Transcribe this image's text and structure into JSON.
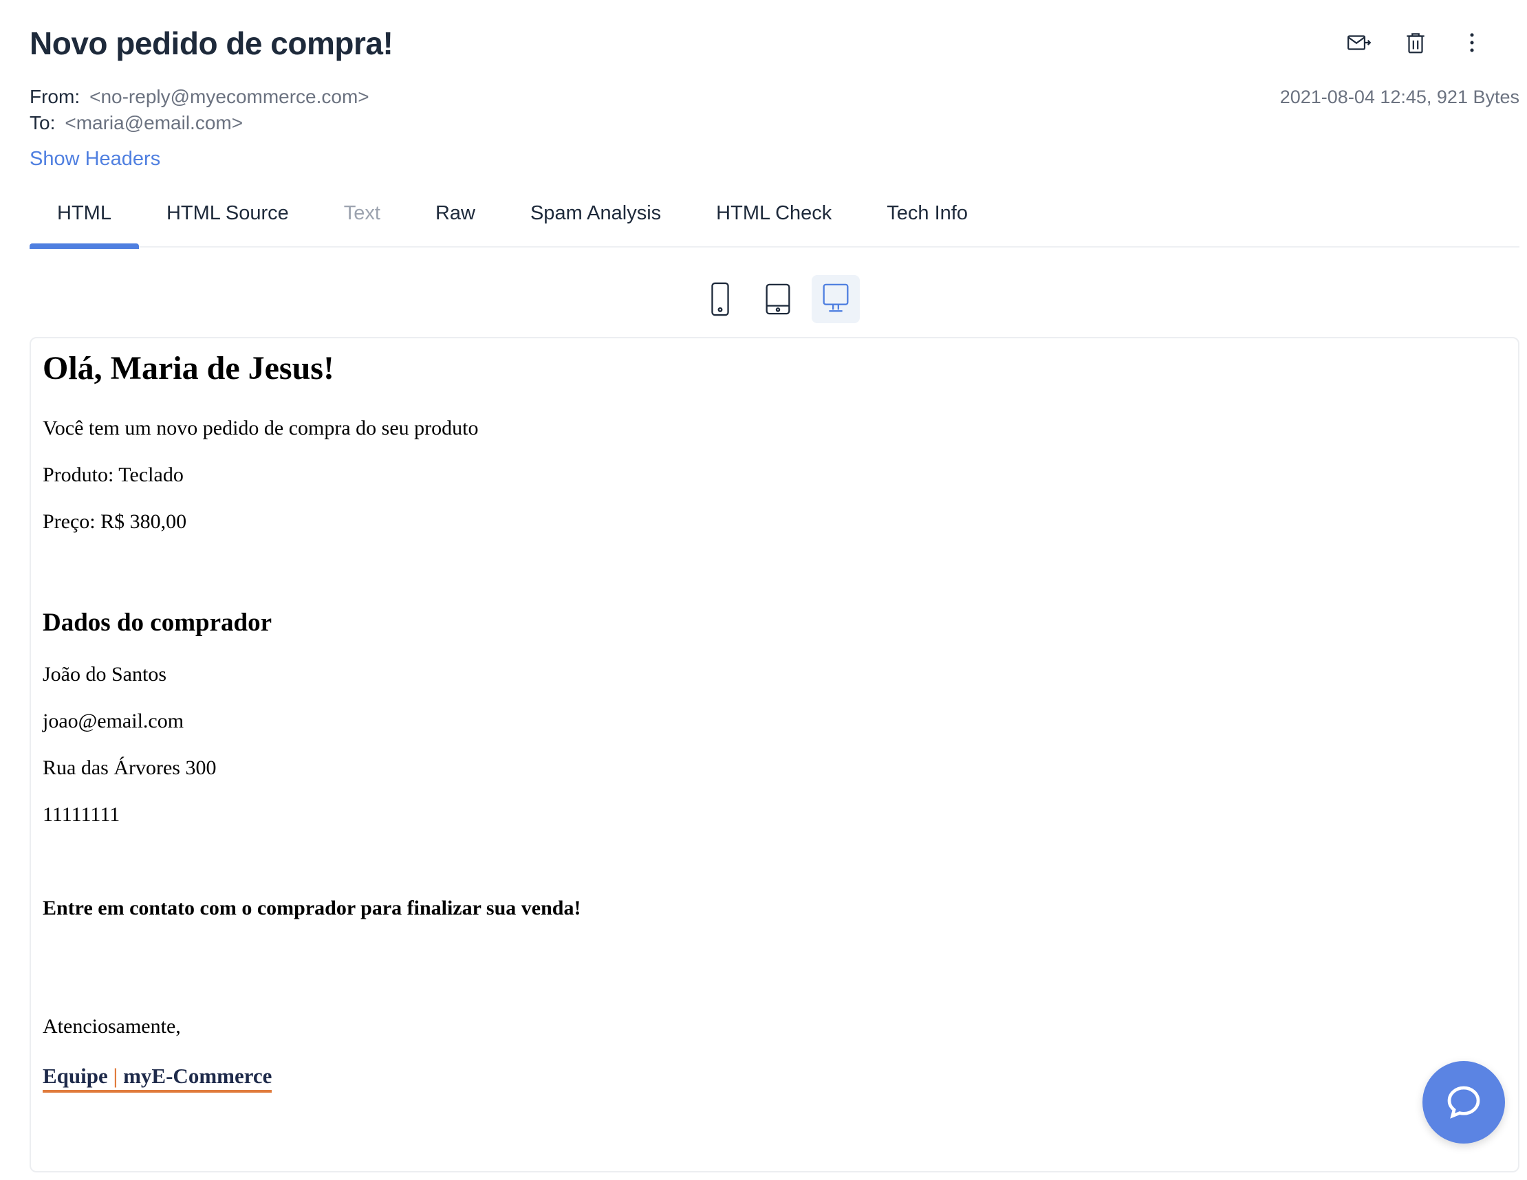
{
  "email": {
    "subject": "Novo pedido de compra!",
    "from_label": "From:",
    "from_value": "<no-reply@myecommerce.com>",
    "to_label": "To:",
    "to_value": "<maria@email.com>",
    "meta_info": "2021-08-04 12:45, 921 Bytes",
    "show_headers": "Show Headers"
  },
  "tabs": [
    {
      "label": "HTML",
      "active": true
    },
    {
      "label": "HTML Source"
    },
    {
      "label": "Text",
      "disabled": true
    },
    {
      "label": "Raw"
    },
    {
      "label": "Spam Analysis"
    },
    {
      "label": "HTML Check"
    },
    {
      "label": "Tech Info"
    }
  ],
  "viewports": [
    "mobile-icon",
    "tablet-icon",
    "desktop-icon"
  ],
  "active_viewport": "desktop",
  "body": {
    "greeting": "Olá, Maria de Jesus!",
    "intro": "Você tem um novo pedido de compra do seu produto",
    "product": "Produto: Teclado",
    "price": "Preço: R$ 380,00",
    "buyer_heading": "Dados do comprador",
    "buyer_name": "João do Santos",
    "buyer_email": "joao@email.com",
    "buyer_address": "Rua das Árvores 300",
    "buyer_zip": "11111111",
    "cta": "Entre em contato com o comprador para finalizar sua venda!",
    "closing": "Atenciosamente,",
    "signature_team": "Equipe",
    "signature_separator": "|",
    "signature_brand": "myE-Commerce"
  },
  "colors": {
    "accent": "#4f7fe0",
    "signature_underline": "#e07b3c",
    "chat_button": "#5b84e3"
  }
}
